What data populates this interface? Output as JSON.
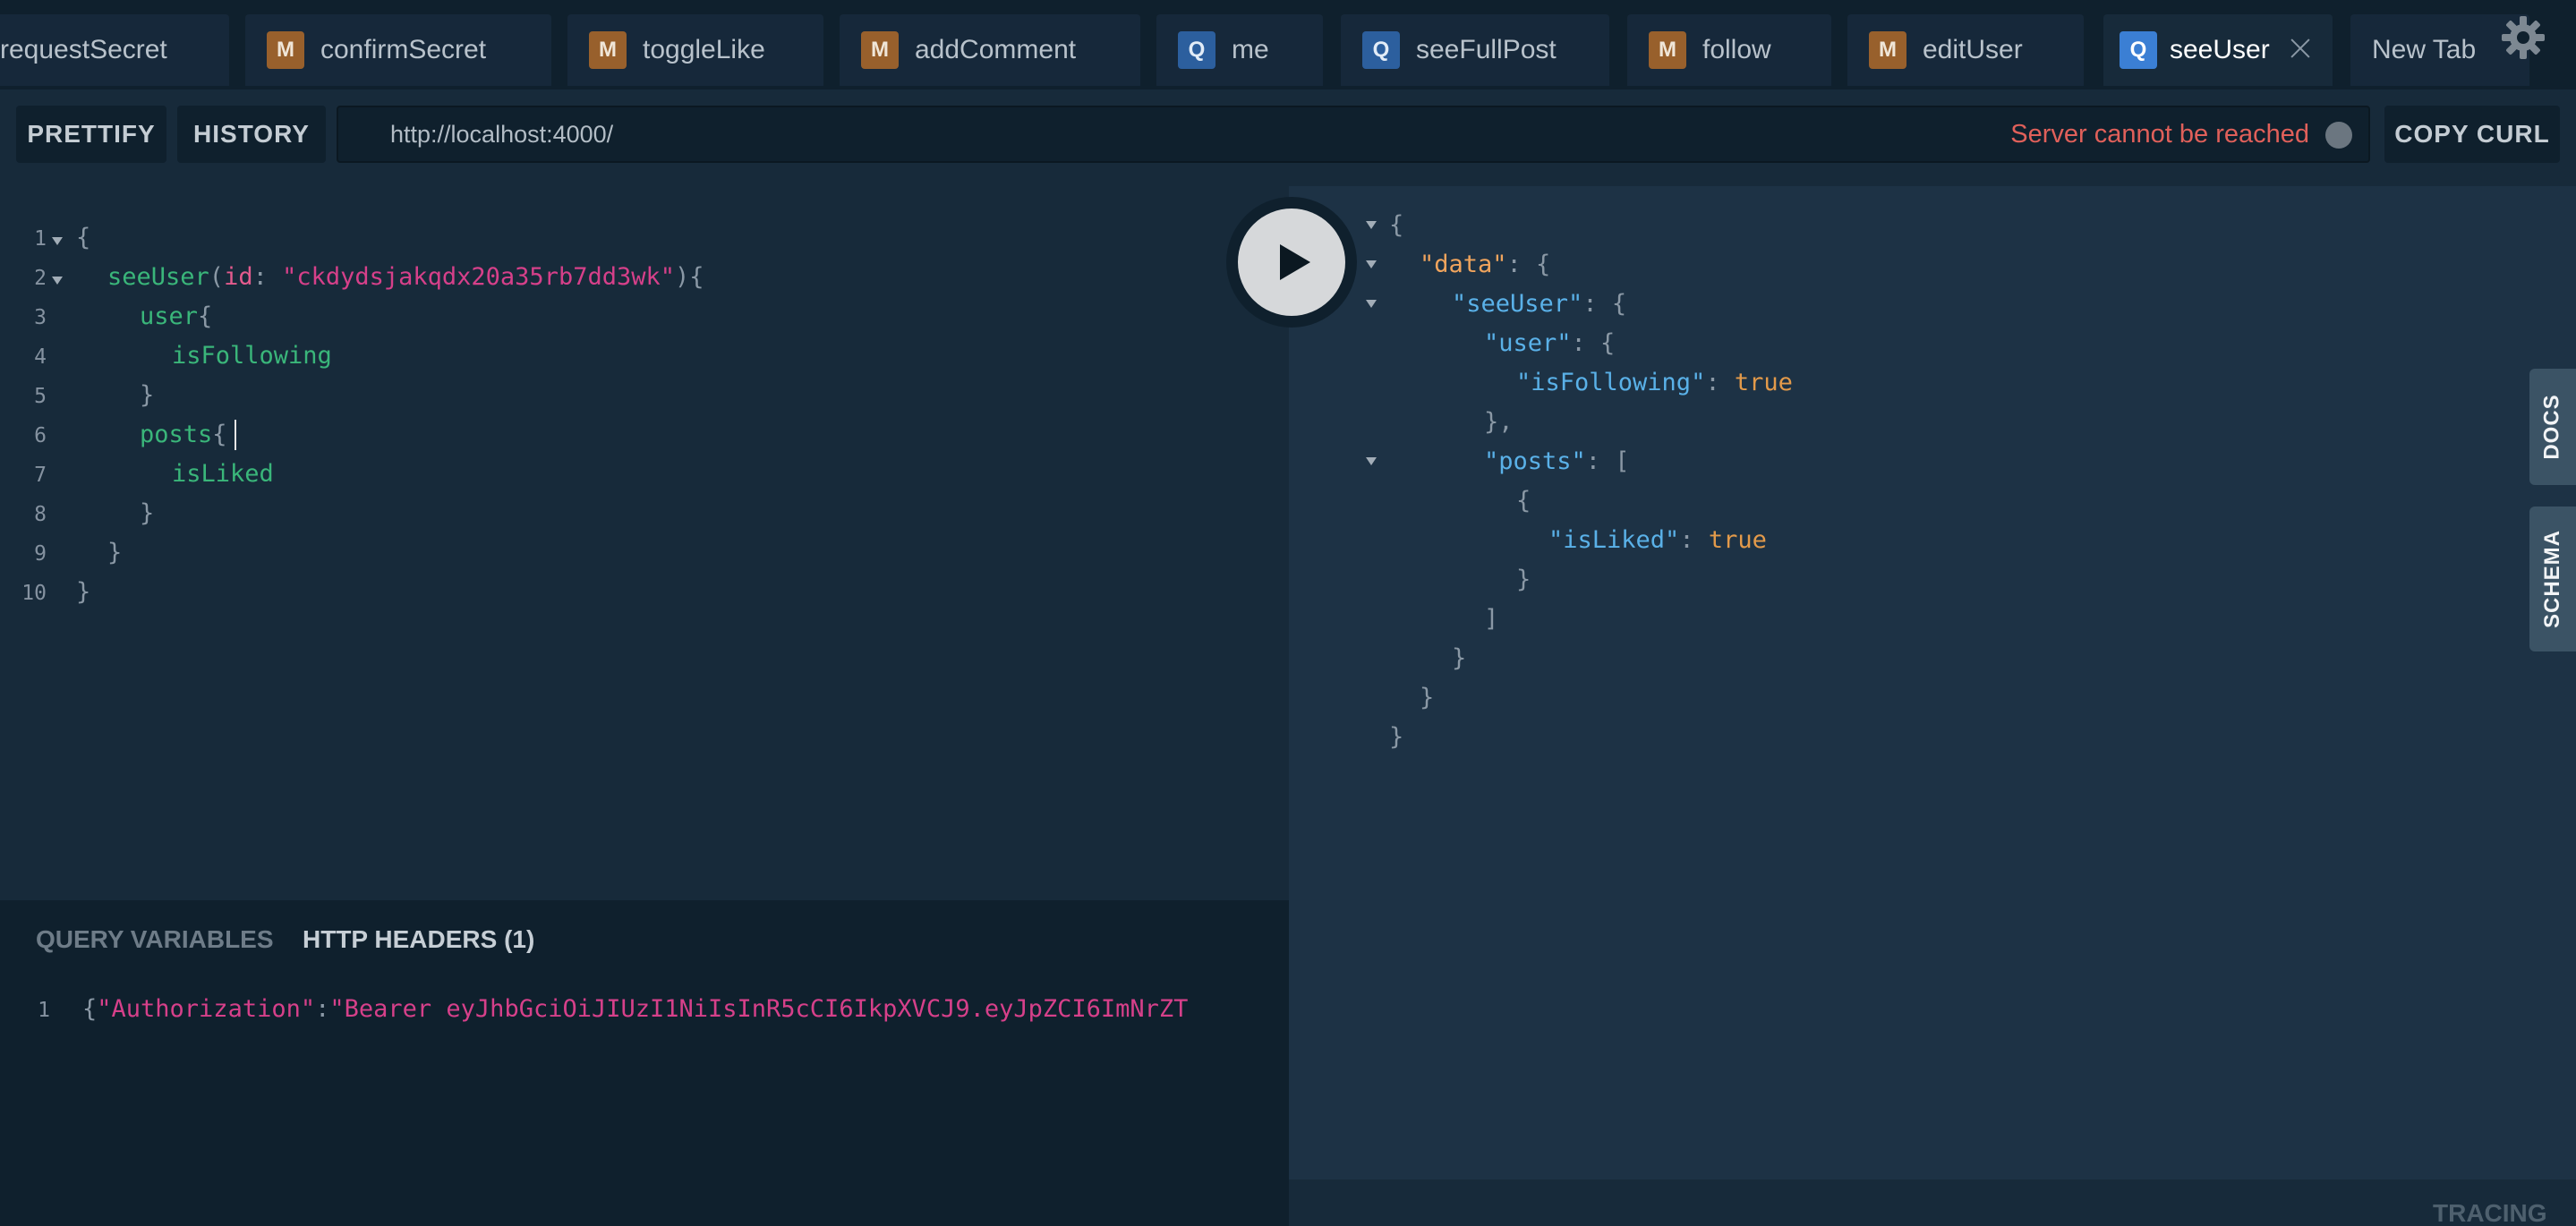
{
  "tabs": [
    {
      "badge": "",
      "label": "requestSecret",
      "active": false
    },
    {
      "badge": "M",
      "label": "confirmSecret",
      "active": false
    },
    {
      "badge": "M",
      "label": "toggleLike",
      "active": false
    },
    {
      "badge": "M",
      "label": "addComment",
      "active": false
    },
    {
      "badge": "Q",
      "label": "me",
      "active": false
    },
    {
      "badge": "Q",
      "label": "seeFullPost",
      "active": false
    },
    {
      "badge": "M",
      "label": "follow",
      "active": false
    },
    {
      "badge": "M",
      "label": "editUser",
      "active": false
    },
    {
      "badge": "Q",
      "label": "seeUser",
      "active": true
    },
    {
      "badge": "",
      "label": "New Tab",
      "active": false
    }
  ],
  "toolbar": {
    "prettify_label": "PRETTIFY",
    "history_label": "HISTORY",
    "url": "http://localhost:4000/",
    "server_status": "Server cannot be reached",
    "copy_curl_label": "COPY CURL"
  },
  "editor": {
    "line_numbers": [
      "1",
      "2",
      "3",
      "4",
      "5",
      "6",
      "7",
      "8",
      "9",
      "10"
    ],
    "lines": [
      {
        "tokens": [
          {
            "t": "{",
            "c": "punc"
          }
        ]
      },
      {
        "tokens": [
          {
            "t": "seeUser",
            "c": "fld"
          },
          {
            "t": "(",
            "c": "punc"
          },
          {
            "t": "id",
            "c": "arg"
          },
          {
            "t": ": ",
            "c": "punc"
          },
          {
            "t": "\"ckdydsjakqdx20a35rb7dd3wk\"",
            "c": "str"
          },
          {
            "t": "){",
            "c": "punc"
          }
        ]
      },
      {
        "tokens": [
          {
            "t": "user",
            "c": "fld"
          },
          {
            "t": "{",
            "c": "punc"
          }
        ]
      },
      {
        "tokens": [
          {
            "t": "isFollowing",
            "c": "fld"
          }
        ]
      },
      {
        "tokens": [
          {
            "t": "}",
            "c": "punc"
          }
        ]
      },
      {
        "tokens": [
          {
            "t": "posts",
            "c": "fld"
          },
          {
            "t": "{",
            "c": "punc"
          }
        ]
      },
      {
        "tokens": [
          {
            "t": "isLiked",
            "c": "fld"
          }
        ]
      },
      {
        "tokens": [
          {
            "t": "}",
            "c": "punc"
          }
        ]
      },
      {
        "tokens": [
          {
            "t": "}",
            "c": "punc"
          }
        ]
      },
      {
        "tokens": [
          {
            "t": "}",
            "c": "punc"
          }
        ]
      }
    ]
  },
  "result": {
    "lines": [
      {
        "tokens": [
          {
            "t": "{",
            "c": "punc"
          }
        ]
      },
      {
        "tokens": [
          {
            "t": "\"data\"",
            "c": "rkey-data"
          },
          {
            "t": ": {",
            "c": "punc"
          }
        ]
      },
      {
        "tokens": [
          {
            "t": "\"seeUser\"",
            "c": "rkey"
          },
          {
            "t": ": {",
            "c": "punc"
          }
        ]
      },
      {
        "tokens": [
          {
            "t": "\"user\"",
            "c": "rkey"
          },
          {
            "t": ": {",
            "c": "punc"
          }
        ]
      },
      {
        "tokens": [
          {
            "t": "\"isFollowing\"",
            "c": "rkey"
          },
          {
            "t": ": ",
            "c": "punc"
          },
          {
            "t": "true",
            "c": "rbool"
          }
        ]
      },
      {
        "tokens": [
          {
            "t": "},",
            "c": "punc"
          }
        ]
      },
      {
        "tokens": [
          {
            "t": "\"posts\"",
            "c": "rkey"
          },
          {
            "t": ": [",
            "c": "punc"
          }
        ]
      },
      {
        "tokens": [
          {
            "t": "{",
            "c": "punc"
          }
        ]
      },
      {
        "tokens": [
          {
            "t": "\"isLiked\"",
            "c": "rkey"
          },
          {
            "t": ": ",
            "c": "punc"
          },
          {
            "t": "true",
            "c": "rbool"
          }
        ]
      },
      {
        "tokens": [
          {
            "t": "}",
            "c": "punc"
          }
        ]
      },
      {
        "tokens": [
          {
            "t": "]",
            "c": "punc"
          }
        ]
      },
      {
        "tokens": [
          {
            "t": "}",
            "c": "punc"
          }
        ]
      },
      {
        "tokens": [
          {
            "t": "}",
            "c": "punc"
          }
        ]
      },
      {
        "tokens": [
          {
            "t": "}",
            "c": "punc"
          }
        ]
      }
    ]
  },
  "side_tabs": {
    "docs": "DOCS",
    "schema": "SCHEMA"
  },
  "bottom_panel": {
    "query_variables_label": "QUERY VARIABLES",
    "http_headers_label": "HTTP HEADERS (1)",
    "line_number": "1",
    "header_tokens": [
      {
        "t": "{",
        "c": "punc"
      },
      {
        "t": "\"Authorization\"",
        "c": "str"
      },
      {
        "t": ":",
        "c": "punc"
      },
      {
        "t": "\"Bearer eyJhbGciOiJIUzI1NiIsInR5cCI6IkpXVCJ9.eyJpZCI6ImNrZT",
        "c": "str"
      }
    ]
  },
  "tracing_label": "TRACING",
  "icons": {
    "settings": "gear-icon",
    "run": "play-icon",
    "close": "close-icon",
    "fold": "fold-arrow-icon"
  },
  "colors": {
    "background": "#172a3a",
    "tab_bar": "#0f202d",
    "result_panel": "#1d3245",
    "field_green": "#3ab67a",
    "string_pink": "#d6408a",
    "error_red": "#e0605a",
    "badge_mutation": "#98602c",
    "badge_query": "#2c5f9e",
    "result_key_blue": "#5ab1e8",
    "result_bool_orange": "#e39a4a"
  }
}
